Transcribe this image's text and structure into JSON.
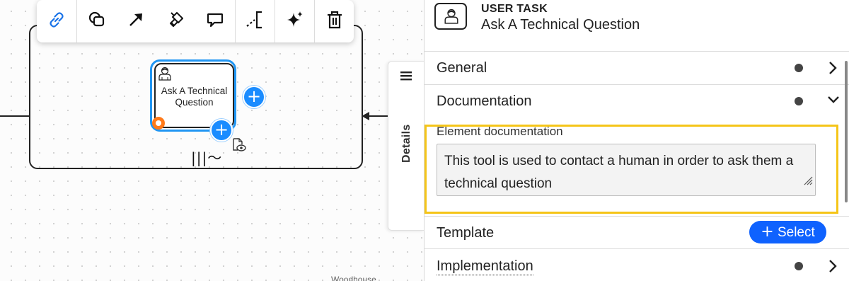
{
  "canvas": {
    "task": {
      "label": "Ask A Technical Question",
      "icon": "user-task-icon",
      "marker": "|||〜"
    },
    "bottom_text": "Woodhouse"
  },
  "context_toolbar": {
    "tools": [
      {
        "name": "link",
        "icon": "link-icon"
      },
      {
        "name": "add-shape",
        "icon": "shapes-icon"
      },
      {
        "name": "connect",
        "icon": "arrow-icon"
      },
      {
        "name": "paint",
        "icon": "paint-bucket-icon"
      },
      {
        "name": "comment",
        "icon": "comment-icon"
      },
      {
        "name": "annotation",
        "icon": "annotation-icon"
      },
      {
        "name": "ai",
        "icon": "sparkle-icon"
      },
      {
        "name": "delete",
        "icon": "trash-icon"
      }
    ],
    "active_color": "#1a73e8"
  },
  "details_tab": {
    "label": "Details"
  },
  "panel": {
    "header": {
      "type": "USER TASK",
      "name": "Ask A Technical Question"
    },
    "sections": {
      "general": {
        "title": "General",
        "expanded": false
      },
      "documentation": {
        "title": "Documentation",
        "expanded": true,
        "field_label": "Element documentation",
        "value": "This tool is used to contact a human in order to ask them a technical question"
      },
      "template": {
        "title": "Template",
        "button_label": "Select"
      },
      "implementation": {
        "title": "Implementation",
        "expanded": false
      }
    },
    "colors": {
      "highlight": "#f5c518",
      "accent": "#0f62fe",
      "selection": "#2196f3",
      "boundary_event": "#ff7a1a"
    }
  }
}
